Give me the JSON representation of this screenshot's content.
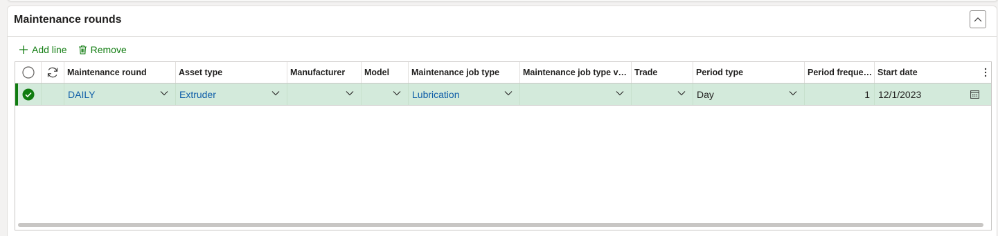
{
  "panel": {
    "title": "Maintenance rounds"
  },
  "toolbar": {
    "add_line": "Add line",
    "remove": "Remove"
  },
  "grid": {
    "columns": [
      "Maintenance round",
      "Asset type",
      "Manufacturer",
      "Model",
      "Maintenance job type",
      "Maintenance job type vari...",
      "Trade",
      "Period type",
      "Period frequen...",
      "Start date"
    ],
    "rows": [
      {
        "maintenance_round": "DAILY",
        "asset_type": "Extruder",
        "manufacturer": "",
        "model": "",
        "maintenance_job_type": "Lubrication",
        "maintenance_job_type_variant": "",
        "trade": "",
        "period_type": "Day",
        "period_frequency": "1",
        "start_date": "12/1/2023",
        "selected": true
      }
    ]
  },
  "colors": {
    "accent": "#107c10",
    "row_selected": "#d3eadb",
    "link": "#0f5ea8"
  },
  "icons": {
    "add": "plus-icon",
    "remove": "trash-icon",
    "collapse": "chevron-up-icon",
    "refresh": "refresh-icon",
    "select_all": "radio-circle-icon",
    "more": "more-vertical-icon",
    "calendar": "calendar-icon",
    "row_check": "check-circle-icon"
  }
}
